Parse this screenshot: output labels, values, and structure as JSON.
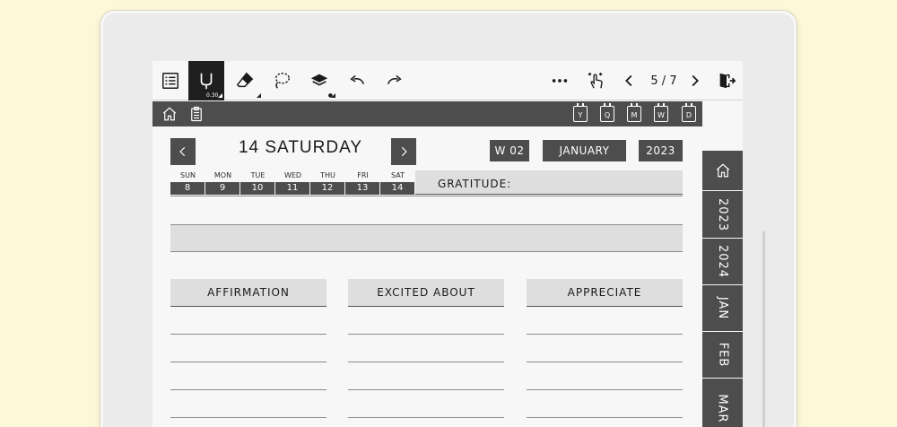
{
  "toolbar": {
    "pen_size": "0.30",
    "page_indicator": "5 / 7"
  },
  "date_header": {
    "title": "14 SATURDAY",
    "week": "W 02",
    "month": "JANUARY",
    "year": "2023"
  },
  "header_strip": {
    "calendar_icons": [
      "Y",
      "Q",
      "M",
      "W",
      "D"
    ]
  },
  "week_strip": [
    {
      "day": "SUN",
      "num": "8"
    },
    {
      "day": "MON",
      "num": "9"
    },
    {
      "day": "TUE",
      "num": "10"
    },
    {
      "day": "WED",
      "num": "11"
    },
    {
      "day": "THU",
      "num": "12"
    },
    {
      "day": "FRI",
      "num": "13"
    },
    {
      "day": "SAT",
      "num": "14"
    }
  ],
  "gratitude_label": "GRATITUDE:",
  "sections": [
    "AFFIRMATION",
    "EXCITED ABOUT",
    "APPRECIATE"
  ],
  "side_tabs": [
    "2023",
    "2024",
    "JAN",
    "FEB",
    "MAR"
  ],
  "colors": {
    "background": "#fdf8d8",
    "dark": "#4d4d4d",
    "panel": "#dedede",
    "paper": "#f7f7f7"
  }
}
